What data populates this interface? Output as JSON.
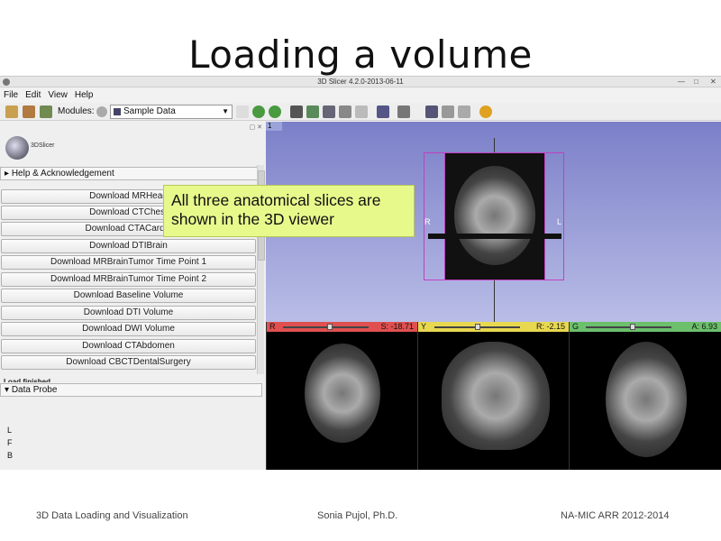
{
  "slide": {
    "title": "Loading a volume",
    "callout": "All three anatomical slices are shown in the 3D viewer",
    "footer_left": "3D Data Loading and Visualization",
    "footer_center": "Sonia Pujol, Ph.D.",
    "footer_right": "NA-MIC ARR 2012-2014"
  },
  "window": {
    "title": "3D Slicer 4.2.0-2013-06-11",
    "controls": [
      "—",
      "□",
      "✕"
    ]
  },
  "menu": [
    "File",
    "Edit",
    "View",
    "Help"
  ],
  "toolbar": {
    "modules_label": "Modules:",
    "module_selected": "Sample Data"
  },
  "left_panel": {
    "logo_text": "3DSlicer",
    "help_section": "Help & Acknowledgement",
    "buttons": [
      "Download MRHead",
      "Download CTChest",
      "Download CTACardio",
      "Download DTIBrain",
      "Download MRBrainTumor Time Point 1",
      "Download MRBrainTumor Time Point 2",
      "Download Baseline Volume",
      "Download DTI Volume",
      "Download DWI Volume",
      "Download CTAbdomen",
      "Download CBCTDentalSurgery"
    ],
    "load_status": "Load finished",
    "data_probe": "Data Probe",
    "orientation": [
      "L",
      "F",
      "B"
    ]
  },
  "views": {
    "view3d_tab": "1",
    "axis_left": "R",
    "axis_right": "L",
    "red": {
      "label": "R",
      "value": "S: -18.71",
      "color": "#e05050",
      "slider": 0.55
    },
    "yellow": {
      "label": "Y",
      "value": "R: -2.15",
      "color": "#e8d850",
      "slider": 0.5
    },
    "green": {
      "label": "G",
      "value": "A: 6.93",
      "color": "#6cc06c",
      "slider": 0.55
    }
  }
}
